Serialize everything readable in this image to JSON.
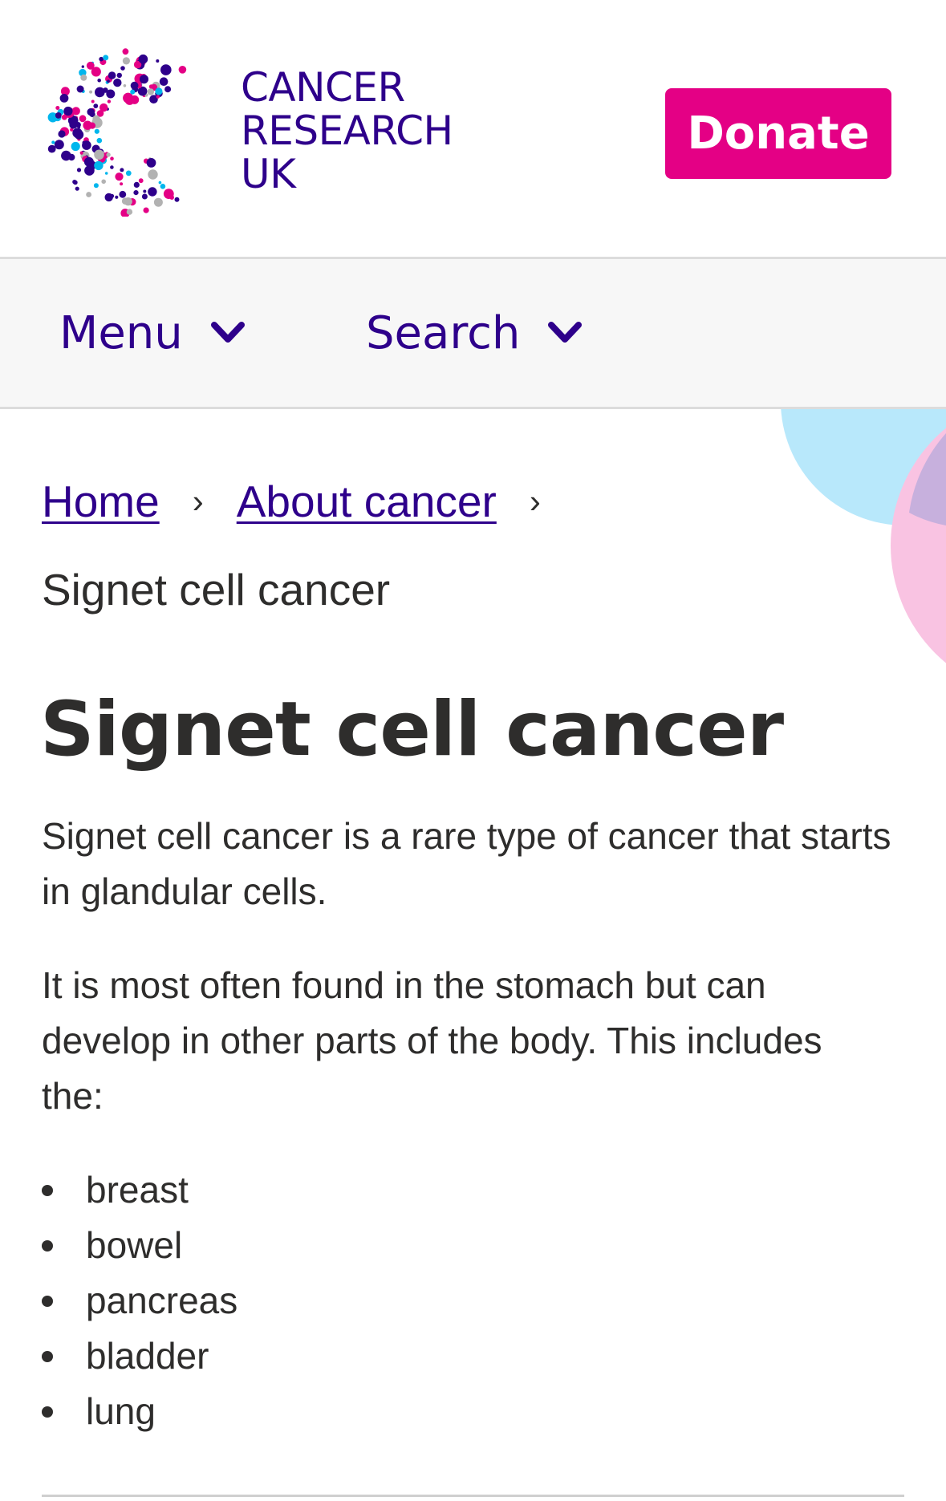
{
  "header": {
    "logo": {
      "line1": "CANCER",
      "line2": "RESEARCH",
      "line3": "UK"
    },
    "donate_label": "Donate"
  },
  "nav": {
    "menu_label": "Menu",
    "search_label": "Search",
    "icons": [
      "chevron-down-icon",
      "chevron-down-icon"
    ]
  },
  "breadcrumb": {
    "items": [
      "Home",
      "About cancer"
    ],
    "separator": "›",
    "current": "Signet cell cancer"
  },
  "page": {
    "title": "Signet cell cancer",
    "paragraphs": [
      "Signet cell cancer is a rare type of cancer that starts in glandular cells.",
      "It is most often found in the stomach but can develop in other parts of the body. This includes the:"
    ],
    "list": [
      "breast",
      "bowel",
      "pancreas",
      "bladder",
      "lung"
    ]
  },
  "colors": {
    "brand_navy": "#2e008b",
    "donate_pink": "#e40085",
    "text": "#2e2d2c",
    "nav_bg": "#f7f7f7",
    "deco_blue": "#b8e8fb",
    "deco_pink": "#f9c3e2",
    "deco_purple": "#c7b0dd"
  }
}
